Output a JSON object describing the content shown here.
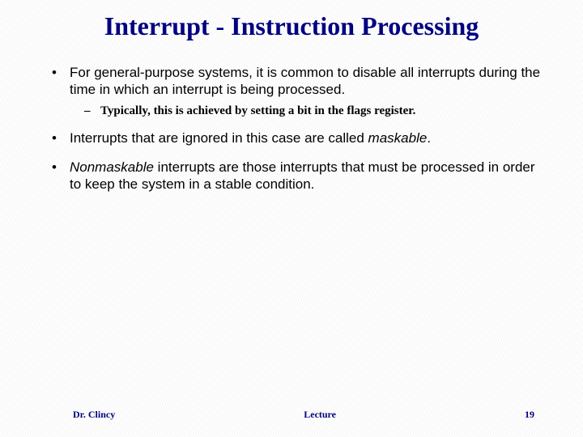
{
  "title": "Interrupt - Instruction Processing",
  "bullets": {
    "b1": "For general-purpose systems, it is common to disable all interrupts during the time in which an interrupt is being processed.",
    "b1_sub1": "Typically, this is achieved by setting a bit in the flags register.",
    "b2_prefix": "Interrupts that are ignored in this case are called ",
    "b2_italic": "maskable",
    "b2_suffix": ".",
    "b3_italic": "Nonmaskable",
    "b3_suffix": " interrupts are those interrupts that must be processed in order to keep the system in a stable condition."
  },
  "footer": {
    "left": "Dr. Clincy",
    "center": "Lecture",
    "right": "19"
  }
}
